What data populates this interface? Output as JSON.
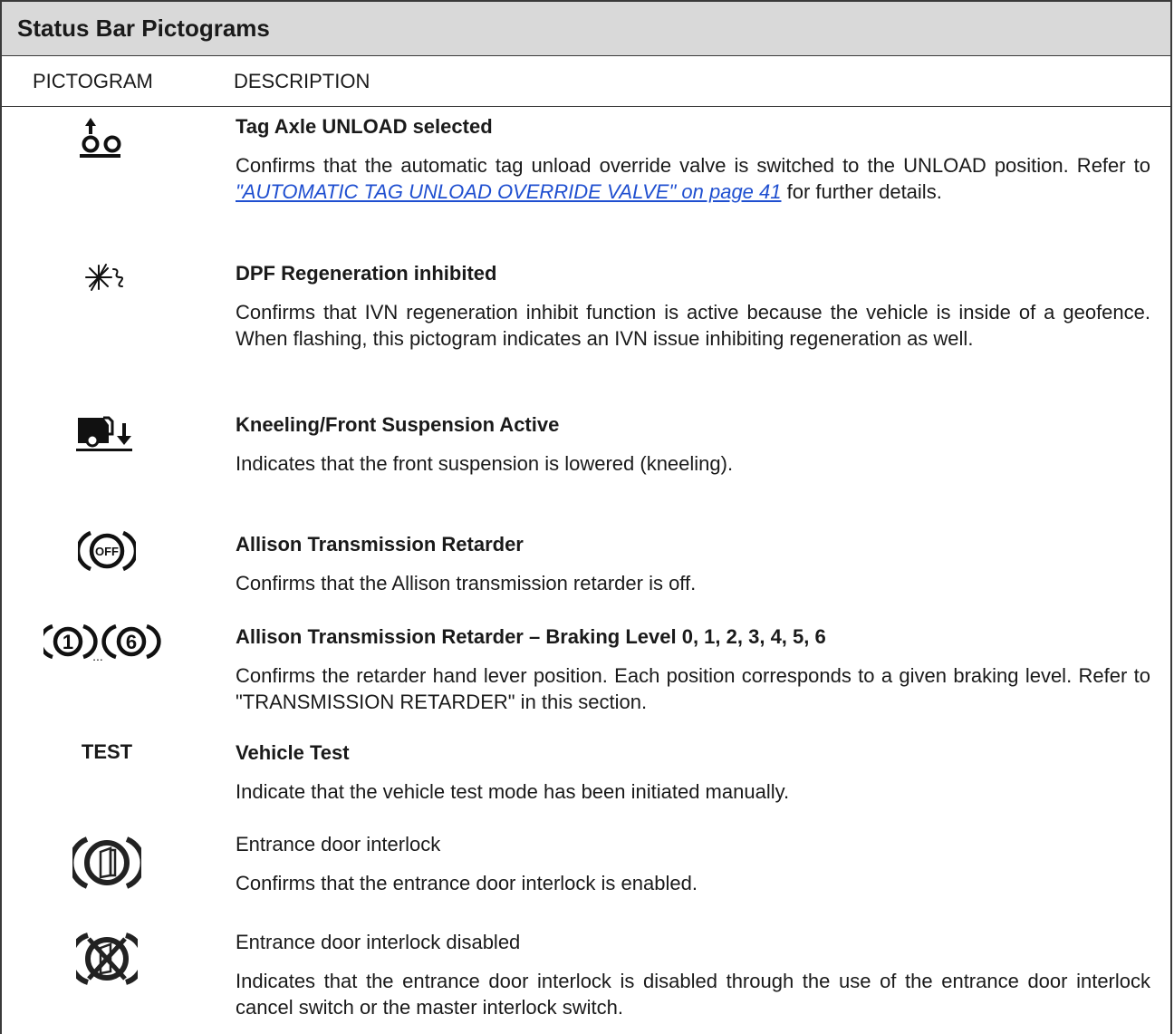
{
  "table": {
    "title": "Status Bar Pictograms",
    "col_pictogram": "PICTOGRAM",
    "col_description": "DESCRIPTION"
  },
  "rows": [
    {
      "icon": "tag-axle-unload-icon",
      "title": "Tag Axle UNLOAD selected",
      "body_pre": "Confirms that the automatic tag unload override valve is switched to the UNLOAD position. Refer to ",
      "link": "\"AUTOMATIC TAG UNLOAD OVERRIDE VALVE\" on page 41",
      "body_post": " for further details."
    },
    {
      "icon": "dpf-regeneration-inhibited-icon",
      "title": "DPF Regeneration inhibited",
      "body": "Confirms that IVN regeneration inhibit function is active because the vehicle is inside of a geofence. When flashing, this pictogram indicates an IVN issue inhibiting regeneration as well."
    },
    {
      "icon": "kneeling-icon",
      "title": "Kneeling/Front Suspension Active",
      "body": "Indicates that the front suspension is lowered (kneeling)."
    },
    {
      "icon": "retarder-off-icon",
      "icon_text": "OFF",
      "title": "Allison Transmission Retarder",
      "body": "Confirms that the Allison transmission retarder is off."
    },
    {
      "icon": "retarder-level-icon",
      "icon_text_1": "1",
      "icon_text_6": "6",
      "icon_ellipsis": "...",
      "title": "Allison Transmission Retarder – Braking Level 0, 1, 2, 3, 4, 5, 6",
      "body": "Confirms the retarder hand lever position. Each position corresponds to a given braking level.  Refer to \"TRANSMISSION RETARDER\" in this section."
    },
    {
      "icon_label": "TEST",
      "title": "Vehicle Test",
      "body": "Indicate that the vehicle test mode has been initiated manually."
    },
    {
      "icon": "door-interlock-icon",
      "title": "Entrance door interlock",
      "body": "Confirms that the entrance door interlock is enabled."
    },
    {
      "icon": "door-interlock-disabled-icon",
      "title": "Entrance door interlock disabled",
      "body": "Indicates that the entrance door interlock is disabled through the use of the entrance door interlock cancel switch or the master interlock switch."
    }
  ],
  "colors": {
    "header_bg": "#d9d9d9",
    "link": "#1f4fd0",
    "text": "#1a1a1a"
  }
}
